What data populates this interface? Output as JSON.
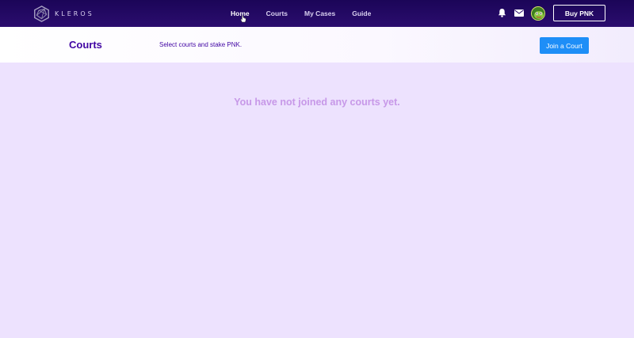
{
  "navbar": {
    "logo_text": "KLEROS",
    "links": [
      {
        "label": "Home",
        "active": true
      },
      {
        "label": "Courts",
        "active": false
      },
      {
        "label": "My Cases",
        "active": false
      },
      {
        "label": "Guide",
        "active": false
      }
    ],
    "icons": [
      "bell-icon",
      "mail-icon",
      "avatar"
    ],
    "buy_label": "Buy PNK"
  },
  "header": {
    "title": "Courts",
    "subtitle": "Select courts and stake PNK.",
    "join_label": "Join a Court"
  },
  "main": {
    "empty_message": "You have not joined any courts yet."
  },
  "colors": {
    "navbar_bg": "#1b0558",
    "title": "#4004a3",
    "button_blue": "#1e8ef7",
    "empty_text": "#c798e8",
    "page_bg": "#ede2fe"
  }
}
